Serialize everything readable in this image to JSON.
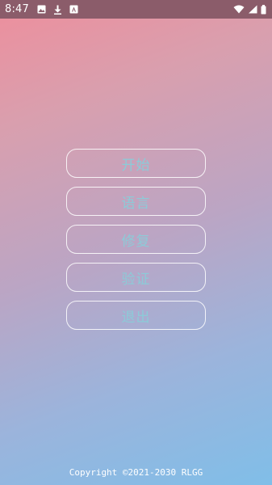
{
  "status_bar": {
    "time": "8:47",
    "left_icons": [
      "image-icon",
      "download-icon",
      "app-a-icon"
    ],
    "right_icons": [
      "wifi-icon",
      "signal-icon",
      "battery-icon"
    ]
  },
  "menu": {
    "items": [
      {
        "label": "开始"
      },
      {
        "label": "语言"
      },
      {
        "label": "修复"
      },
      {
        "label": "验证"
      },
      {
        "label": "退出"
      }
    ]
  },
  "footer": {
    "copyright": "Copyright ©2021-2030 RLGG"
  },
  "colors": {
    "status_bar": "#8b5c6a",
    "gradient_top": "#ee8e9c",
    "gradient_bottom": "#80bee8",
    "button_text": "#8ccbd8",
    "button_border": "#ffffff"
  }
}
